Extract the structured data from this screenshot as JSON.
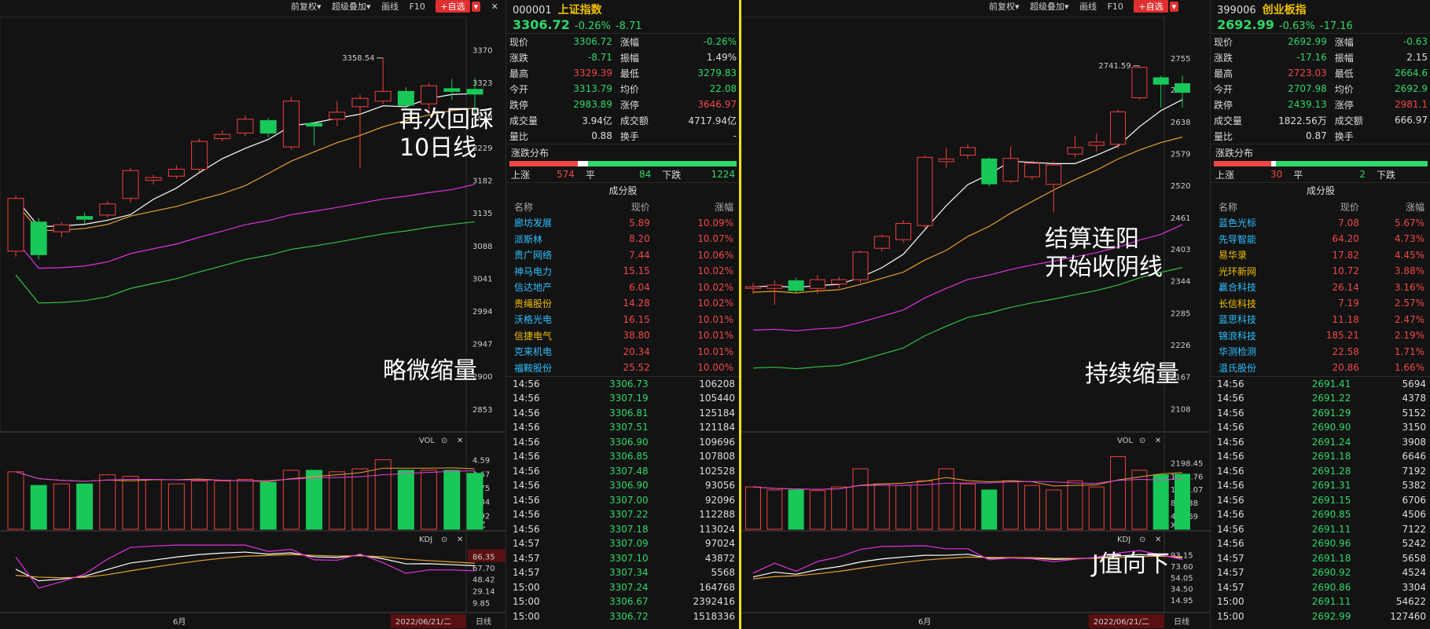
{
  "left": {
    "toolbar": {
      "adjust": "前复权▾",
      "overlay": "超级叠加▾",
      "draw": "画线",
      "f10": "F10",
      "add": "+自选",
      "arrow": "▾"
    },
    "y_ticks": [
      "3370",
      "3323",
      "3276",
      "3229",
      "3182",
      "3135",
      "3088",
      "3041",
      "2994",
      "2947",
      "2900",
      "2853"
    ],
    "high_label": "3358.54",
    "vol_label": "VOL",
    "vol_ticks": [
      "4.59",
      "3.67",
      "2.75",
      "1.84",
      "0.92"
    ],
    "vol_unit": "X亿",
    "kdj_label": "KDJ",
    "kdj_ticks": [
      "86.35",
      "67.70",
      "48.42",
      "29.14",
      "9.85"
    ],
    "month": "6月",
    "date": "2022/06/21/二",
    "period": "日线",
    "annotations": {
      "a1": "再次回踩",
      "a2": "10日线",
      "a3": "略微缩量"
    },
    "candles": [
      {
        "o": 3080,
        "c": 3156,
        "h": 3160,
        "l": 3072
      },
      {
        "o": 3122,
        "c": 3075,
        "h": 3128,
        "l": 3068
      },
      {
        "o": 3108,
        "c": 3118,
        "h": 3122,
        "l": 3100
      },
      {
        "o": 3130,
        "c": 3126,
        "h": 3136,
        "l": 3120
      },
      {
        "o": 3132,
        "c": 3148,
        "h": 3152,
        "l": 3128
      },
      {
        "o": 3156,
        "c": 3196,
        "h": 3200,
        "l": 3150
      },
      {
        "o": 3182,
        "c": 3186,
        "h": 3190,
        "l": 3176
      },
      {
        "o": 3188,
        "c": 3198,
        "h": 3204,
        "l": 3184
      },
      {
        "o": 3198,
        "c": 3238,
        "h": 3242,
        "l": 3194
      },
      {
        "o": 3242,
        "c": 3248,
        "h": 3254,
        "l": 3238
      },
      {
        "o": 3250,
        "c": 3270,
        "h": 3276,
        "l": 3246
      },
      {
        "o": 3268,
        "c": 3250,
        "h": 3272,
        "l": 3244
      },
      {
        "o": 3230,
        "c": 3296,
        "h": 3302,
        "l": 3226
      },
      {
        "o": 3264,
        "c": 3260,
        "h": 3266,
        "l": 3232
      },
      {
        "o": 3270,
        "c": 3280,
        "h": 3296,
        "l": 3260
      },
      {
        "o": 3288,
        "c": 3300,
        "h": 3305,
        "l": 3200
      },
      {
        "o": 3296,
        "c": 3310,
        "h": 3358,
        "l": 3292
      },
      {
        "o": 3310,
        "c": 3290,
        "h": 3316,
        "l": 3285
      },
      {
        "o": 3292,
        "c": 3318,
        "h": 3322,
        "l": 3280
      },
      {
        "o": 3314,
        "c": 3310,
        "h": 3328,
        "l": 3298
      },
      {
        "o": 3313,
        "c": 3306,
        "h": 3329,
        "l": 3279
      }
    ],
    "volumes": [
      3.8,
      2.9,
      3.0,
      3.0,
      3.6,
      3.5,
      3.3,
      3.0,
      3.2,
      3.2,
      3.3,
      3.1,
      3.9,
      3.9,
      3.8,
      4.0,
      4.6,
      3.9,
      3.9,
      3.9,
      3.7
    ]
  },
  "left_quote": {
    "code": "000001",
    "name": "上证指数",
    "price": "3306.72",
    "pct": "-0.26%",
    "chg": "-8.71",
    "rows": [
      {
        "l1": "现价",
        "v1": "3306.72",
        "c1": "green",
        "l2": "涨幅",
        "v2": "-0.26%",
        "c2": "green"
      },
      {
        "l1": "涨跌",
        "v1": "-8.71",
        "c1": "green",
        "l2": "振幅",
        "v2": "1.49%",
        "c2": "white"
      },
      {
        "l1": "最高",
        "v1": "3329.39",
        "c1": "red",
        "l2": "最低",
        "v2": "3279.83",
        "c2": "green"
      },
      {
        "l1": "今开",
        "v1": "3313.79",
        "c1": "green",
        "l2": "均价",
        "v2": "22.08",
        "c2": "green"
      },
      {
        "l1": "跌停",
        "v1": "2983.89",
        "c1": "green",
        "l2": "涨停",
        "v2": "3646.97",
        "c2": "red"
      },
      {
        "l1": "成交量",
        "v1": "3.94亿",
        "c1": "white",
        "l2": "成交额",
        "v2": "4717.94亿",
        "c2": "white"
      },
      {
        "l1": "量比",
        "v1": "0.88",
        "c1": "white",
        "l2": "换手",
        "v2": "-",
        "c2": "white"
      }
    ],
    "breadth_title": "涨跌分布",
    "up_label": "上涨",
    "up": "574",
    "flat_label": "平",
    "flat": "84",
    "down_label": "下跌",
    "down": "1224",
    "components_title": "成分股",
    "comp_header": {
      "name": "名称",
      "price": "现价",
      "pct": "涨幅"
    },
    "components": [
      {
        "name": "廊坊发展",
        "price": "5.89",
        "pct": "10.09%",
        "nc": "cyan"
      },
      {
        "name": "派斯林",
        "price": "8.20",
        "pct": "10.07%",
        "nc": "cyan"
      },
      {
        "name": "贵广网络",
        "price": "7.44",
        "pct": "10.06%",
        "nc": "cyan"
      },
      {
        "name": "神马电力",
        "price": "15.15",
        "pct": "10.02%",
        "nc": "cyan"
      },
      {
        "name": "信达地产",
        "price": "6.04",
        "pct": "10.02%",
        "nc": "cyan"
      },
      {
        "name": "贵绳股份",
        "price": "14.28",
        "pct": "10.02%",
        "nc": "yellow"
      },
      {
        "name": "沃格光电",
        "price": "16.15",
        "pct": "10.01%",
        "nc": "cyan"
      },
      {
        "name": "信捷电气",
        "price": "38.80",
        "pct": "10.01%",
        "nc": "yellow"
      },
      {
        "name": "克来机电",
        "price": "20.34",
        "pct": "10.01%",
        "nc": "cyan"
      },
      {
        "name": "福鞍股份",
        "price": "25.52",
        "pct": "10.00%",
        "nc": "cyan"
      }
    ],
    "ticks": [
      {
        "t": "14:56",
        "p": "3306.73",
        "v": "106208"
      },
      {
        "t": "14:56",
        "p": "3307.19",
        "v": "105440"
      },
      {
        "t": "14:56",
        "p": "3306.81",
        "v": "125184"
      },
      {
        "t": "14:56",
        "p": "3307.51",
        "v": "121184"
      },
      {
        "t": "14:56",
        "p": "3306.90",
        "v": "109696"
      },
      {
        "t": "14:56",
        "p": "3306.85",
        "v": "107808"
      },
      {
        "t": "14:56",
        "p": "3307.48",
        "v": "102528"
      },
      {
        "t": "14:56",
        "p": "3306.90",
        "v": "93056"
      },
      {
        "t": "14:56",
        "p": "3307.00",
        "v": "92096"
      },
      {
        "t": "14:56",
        "p": "3307.22",
        "v": "112288"
      },
      {
        "t": "14:56",
        "p": "3307.18",
        "v": "113024"
      },
      {
        "t": "14:57",
        "p": "3307.09",
        "v": "97024"
      },
      {
        "t": "14:57",
        "p": "3307.10",
        "v": "43872"
      },
      {
        "t": "14:57",
        "p": "3307.34",
        "v": "5568"
      },
      {
        "t": "15:00",
        "p": "3307.24",
        "v": "164768"
      },
      {
        "t": "15:00",
        "p": "3306.67",
        "v": "2392416"
      },
      {
        "t": "15:00",
        "p": "3306.72",
        "v": "1518336"
      }
    ]
  },
  "right": {
    "toolbar": {
      "adjust": "前复权▾",
      "overlay": "超级叠加▾",
      "draw": "画线",
      "f10": "F10",
      "add": "+自选",
      "arrow": "▾"
    },
    "y_ticks": [
      "2755",
      "2697",
      "2638",
      "2579",
      "2520",
      "2461",
      "2403",
      "2344",
      "2285",
      "2226",
      "2167",
      "2108"
    ],
    "high_label": "2741.59",
    "vol_label": "VOL",
    "vol_ticks": [
      "2198.45",
      "1758.76",
      "1319.07",
      "879.38",
      "439.69"
    ],
    "vol_unit": "X万",
    "kdj_label": "KDJ",
    "kdj_ticks": [
      "93.15",
      "73.60",
      "54.05",
      "34.50",
      "14.95"
    ],
    "month": "6月",
    "date": "2022/06/21/二",
    "period": "日线",
    "annotations": {
      "a1": "结算连阳",
      "a2": "开始收阴线",
      "a3": "持续缩量",
      "a4": "J值向下"
    },
    "candles": [
      {
        "o": 2330,
        "c": 2333,
        "h": 2340,
        "l": 2320
      },
      {
        "o": 2330,
        "c": 2336,
        "h": 2345,
        "l": 2300
      },
      {
        "o": 2344,
        "c": 2326,
        "h": 2350,
        "l": 2320
      },
      {
        "o": 2330,
        "c": 2346,
        "h": 2355,
        "l": 2320
      },
      {
        "o": 2338,
        "c": 2346,
        "h": 2352,
        "l": 2330
      },
      {
        "o": 2346,
        "c": 2397,
        "h": 2400,
        "l": 2340
      },
      {
        "o": 2404,
        "c": 2426,
        "h": 2430,
        "l": 2398
      },
      {
        "o": 2420,
        "c": 2450,
        "h": 2456,
        "l": 2414
      },
      {
        "o": 2446,
        "c": 2572,
        "h": 2576,
        "l": 2440
      },
      {
        "o": 2564,
        "c": 2569,
        "h": 2590,
        "l": 2552
      },
      {
        "o": 2576,
        "c": 2590,
        "h": 2596,
        "l": 2570
      },
      {
        "o": 2569,
        "c": 2523,
        "h": 2572,
        "l": 2518
      },
      {
        "o": 2528,
        "c": 2570,
        "h": 2592,
        "l": 2524
      },
      {
        "o": 2536,
        "c": 2561,
        "h": 2566,
        "l": 2530
      },
      {
        "o": 2522,
        "c": 2558,
        "h": 2565,
        "l": 2470
      },
      {
        "o": 2578,
        "c": 2590,
        "h": 2612,
        "l": 2572
      },
      {
        "o": 2594,
        "c": 2600,
        "h": 2616,
        "l": 2582
      },
      {
        "o": 2596,
        "c": 2656,
        "h": 2660,
        "l": 2588
      },
      {
        "o": 2682,
        "c": 2738,
        "h": 2741,
        "l": 2678
      },
      {
        "o": 2719,
        "c": 2707,
        "h": 2723,
        "l": 2664
      },
      {
        "o": 2708,
        "c": 2692,
        "h": 2723,
        "l": 2664
      }
    ],
    "volumes": [
      1400,
      1300,
      1300,
      1280,
      1400,
      2000,
      1500,
      1450,
      1600,
      2000,
      1500,
      1300,
      1600,
      1450,
      1300,
      1600,
      1400,
      2400,
      1950,
      1800,
      1822
    ]
  },
  "right_quote": {
    "code": "399006",
    "name": "创业板指",
    "price": "2692.99",
    "pct": "-0.63%",
    "chg": "-17.16",
    "rows": [
      {
        "l1": "现价",
        "v1": "2692.99",
        "c1": "green",
        "l2": "涨幅",
        "v2": "-0.63",
        "c2": "green"
      },
      {
        "l1": "涨跌",
        "v1": "-17.16",
        "c1": "green",
        "l2": "振幅",
        "v2": "2.15",
        "c2": "white"
      },
      {
        "l1": "最高",
        "v1": "2723.03",
        "c1": "red",
        "l2": "最低",
        "v2": "2664.6",
        "c2": "green"
      },
      {
        "l1": "今开",
        "v1": "2707.98",
        "c1": "green",
        "l2": "均价",
        "v2": "2692.9",
        "c2": "green"
      },
      {
        "l1": "跌停",
        "v1": "2439.13",
        "c1": "green",
        "l2": "涨停",
        "v2": "2981.1",
        "c2": "red"
      },
      {
        "l1": "成交量",
        "v1": "1822.56万",
        "c1": "white",
        "l2": "成交额",
        "v2": "666.97",
        "c2": "white"
      },
      {
        "l1": "量比",
        "v1": "0.87",
        "c1": "white",
        "l2": "换手",
        "v2": "",
        "c2": "white"
      }
    ],
    "breadth_title": "涨跌分布",
    "up_label": "上涨",
    "up": "30",
    "flat_label": "平",
    "flat": "2",
    "down_label": "下跌",
    "down": "",
    "components_title": "成分股",
    "comp_header": {
      "name": "名称",
      "price": "现价",
      "pct": "涨幅"
    },
    "components": [
      {
        "name": "蓝色光标",
        "price": "7.08",
        "pct": "5.67%",
        "nc": "cyan"
      },
      {
        "name": "先导智能",
        "price": "64.20",
        "pct": "4.73%",
        "nc": "cyan"
      },
      {
        "name": "易华录",
        "price": "17.82",
        "pct": "4.45%",
        "nc": "yellow"
      },
      {
        "name": "光环新网",
        "price": "10.72",
        "pct": "3.88%",
        "nc": "yellow"
      },
      {
        "name": "赢合科技",
        "price": "26.14",
        "pct": "3.16%",
        "nc": "cyan"
      },
      {
        "name": "长信科技",
        "price": "7.19",
        "pct": "2.57%",
        "nc": "yellow"
      },
      {
        "name": "蓝思科技",
        "price": "11.18",
        "pct": "2.47%",
        "nc": "cyan"
      },
      {
        "name": "锦浪科技",
        "price": "185.21",
        "pct": "2.19%",
        "nc": "cyan"
      },
      {
        "name": "华测检测",
        "price": "22.58",
        "pct": "1.71%",
        "nc": "cyan"
      },
      {
        "name": "温氏股份",
        "price": "20.86",
        "pct": "1.66%",
        "nc": "cyan"
      }
    ],
    "ticks": [
      {
        "t": "14:56",
        "p": "2691.41",
        "v": "5694"
      },
      {
        "t": "14:56",
        "p": "2691.22",
        "v": "4378"
      },
      {
        "t": "14:56",
        "p": "2691.29",
        "v": "5152"
      },
      {
        "t": "14:56",
        "p": "2690.90",
        "v": "3150"
      },
      {
        "t": "14:56",
        "p": "2691.24",
        "v": "3908"
      },
      {
        "t": "14:56",
        "p": "2691.18",
        "v": "6646"
      },
      {
        "t": "14:56",
        "p": "2691.28",
        "v": "7192"
      },
      {
        "t": "14:56",
        "p": "2691.31",
        "v": "5382"
      },
      {
        "t": "14:56",
        "p": "2691.15",
        "v": "6706"
      },
      {
        "t": "14:56",
        "p": "2690.85",
        "v": "4506"
      },
      {
        "t": "14:56",
        "p": "2691.11",
        "v": "7122"
      },
      {
        "t": "14:56",
        "p": "2690.96",
        "v": "5242"
      },
      {
        "t": "14:57",
        "p": "2691.18",
        "v": "5658"
      },
      {
        "t": "14:57",
        "p": "2690.92",
        "v": "4524"
      },
      {
        "t": "14:57",
        "p": "2690.86",
        "v": "3304"
      },
      {
        "t": "15:00",
        "p": "2691.11",
        "v": "54622"
      },
      {
        "t": "15:00",
        "p": "2692.99",
        "v": "127460"
      }
    ]
  }
}
